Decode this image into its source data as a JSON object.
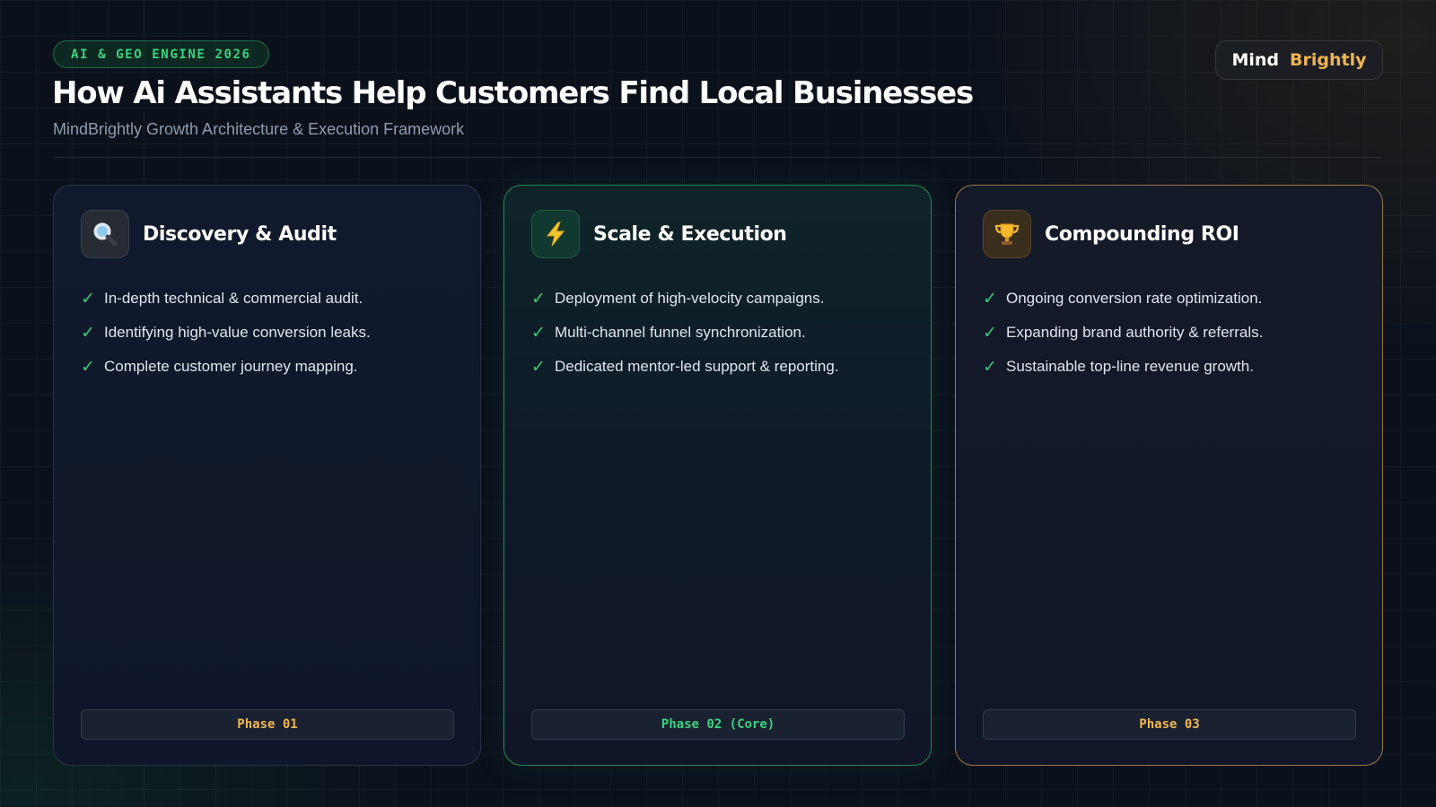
{
  "header": {
    "badge": "AI & GEO ENGINE 2026",
    "title": "How Ai Assistants Help Customers Find Local Businesses",
    "subtitle": "MindBrightly Growth Architecture & Execution Framework",
    "brand": {
      "word1": "Mind",
      "word2": "Brightly"
    }
  },
  "colors": {
    "accent_green": "#38d27f",
    "accent_gold": "#f1b54f",
    "background": "#0b111b"
  },
  "cards": [
    {
      "icon": "magnifier-icon",
      "title": "Discovery & Audit",
      "items": [
        "In-depth technical & commercial audit.",
        "Identifying high-value conversion leaks.",
        "Complete customer journey mapping."
      ],
      "phase": "Phase 01"
    },
    {
      "icon": "lightning-icon",
      "title": "Scale & Execution",
      "items": [
        "Deployment of high-velocity campaigns.",
        "Multi-channel funnel synchronization.",
        "Dedicated mentor-led support & reporting."
      ],
      "phase": "Phase 02 (Core)"
    },
    {
      "icon": "trophy-icon",
      "title": "Compounding ROI",
      "items": [
        "Ongoing conversion rate optimization.",
        "Expanding brand authority & referrals.",
        "Sustainable top-line revenue growth."
      ],
      "phase": "Phase 03"
    }
  ]
}
